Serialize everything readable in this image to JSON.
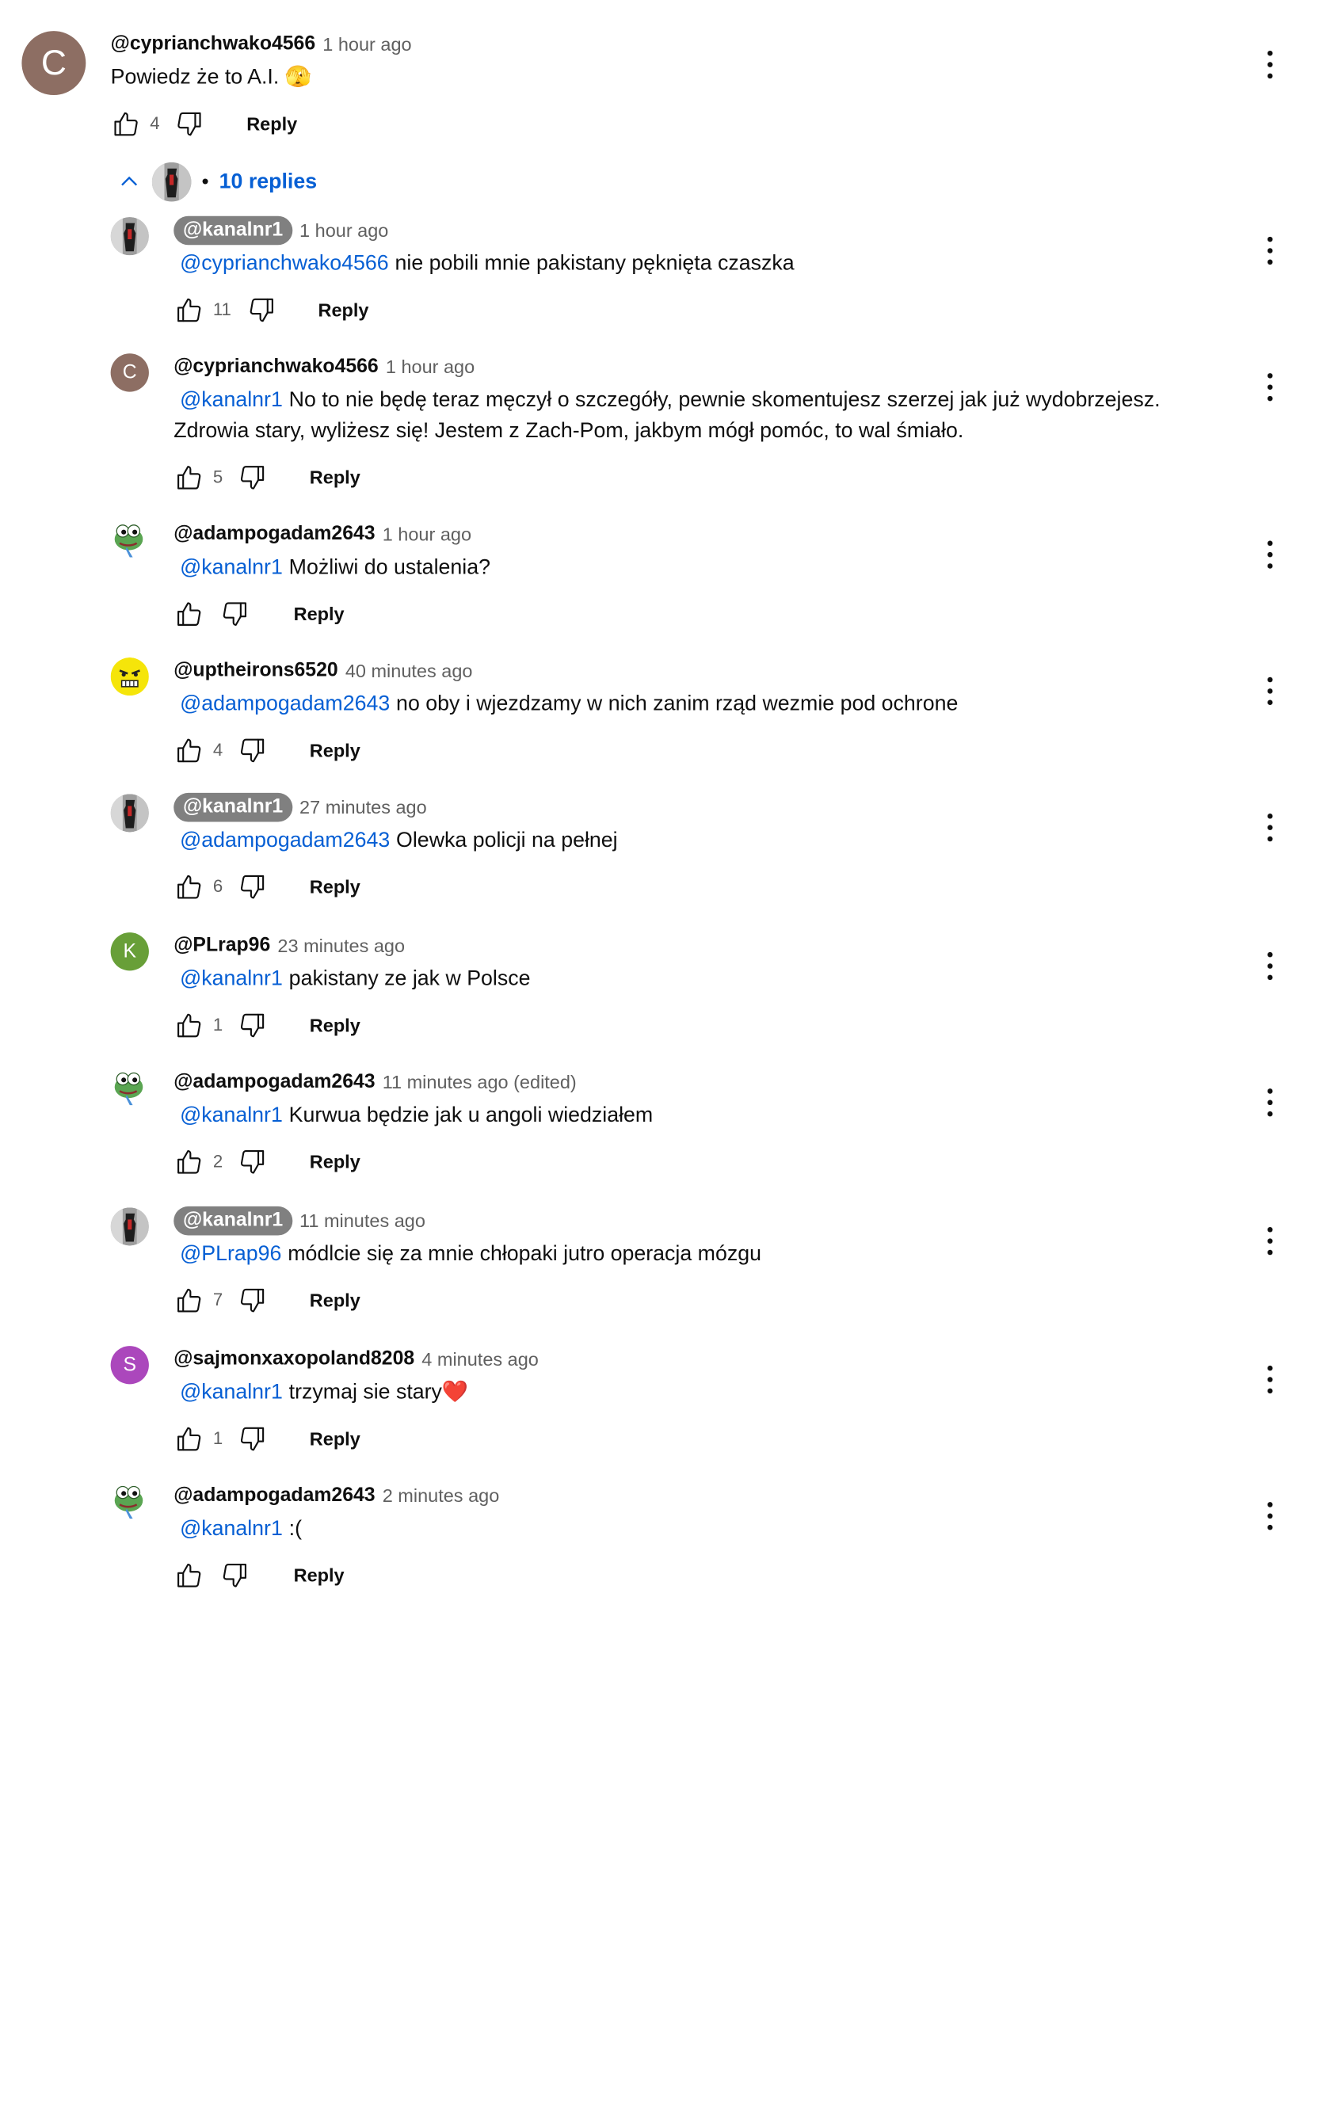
{
  "top_comment": {
    "author": "@cyprianchwako4566",
    "time": "1 hour ago",
    "text": "Powiedz że to A.I. 🫣",
    "likes": "4",
    "reply_label": "Reply",
    "avatar_letter": "C",
    "avatar_color": "#8d6e63"
  },
  "replies_toggle": {
    "count_label": "10 replies",
    "bullet": "•"
  },
  "replies": [
    {
      "author": "@kanalnr1",
      "owner": true,
      "time": "1 hour ago",
      "mention": "@cyprianchwako4566",
      "text": "nie pobili mnie pakistany pęknięta czaszka",
      "likes": "11",
      "reply_label": "Reply",
      "avatar": "photo"
    },
    {
      "author": "@cyprianchwako4566",
      "owner": false,
      "time": "1 hour ago",
      "mention": "@kanalnr1",
      "text": "No to nie będę teraz męczył o szczegóły, pewnie skomentujesz szerzej jak już wydobrzejesz.",
      "text2": "Zdrowia stary, wyliżesz się! Jestem z Zach-Pom, jakbym mógł pomóc, to wal śmiało.",
      "likes": "5",
      "reply_label": "Reply",
      "avatar": "letter",
      "avatar_letter": "C",
      "avatar_color": "#8d6e63"
    },
    {
      "author": "@adampogadam2643",
      "owner": false,
      "time": "1 hour ago",
      "mention": "@kanalnr1",
      "text": "Możliwi do ustalenia?",
      "likes": "",
      "reply_label": "Reply",
      "avatar": "frog"
    },
    {
      "author": "@uptheirons6520",
      "owner": false,
      "time": "40 minutes ago",
      "mention": "@adampogadam2643",
      "text": "no oby i wjezdzamy w nich zanim rząd wezmie pod ochrone",
      "likes": "4",
      "reply_label": "Reply",
      "avatar": "yellow"
    },
    {
      "author": "@kanalnr1",
      "owner": true,
      "time": "27 minutes ago",
      "mention": "@adampogadam2643",
      "text": "Olewka policji na pełnej",
      "likes": "6",
      "reply_label": "Reply",
      "avatar": "photo"
    },
    {
      "author": "@PLrap96",
      "owner": false,
      "time": "23 minutes ago",
      "mention": "@kanalnr1",
      "text": "pakistany ze jak w Polsce",
      "likes": "1",
      "reply_label": "Reply",
      "avatar": "letter",
      "avatar_letter": "K",
      "avatar_color": "#689f38"
    },
    {
      "author": "@adampogadam2643",
      "owner": false,
      "time": "11 minutes ago (edited)",
      "mention": "@kanalnr1",
      "text": "Kurwua będzie jak u angoli wiedziałem",
      "likes": "2",
      "reply_label": "Reply",
      "avatar": "frog"
    },
    {
      "author": "@kanalnr1",
      "owner": true,
      "time": "11 minutes ago",
      "mention": "@PLrap96",
      "text": "módlcie się za mnie chłopaki jutro operacja mózgu",
      "likes": "7",
      "reply_label": "Reply",
      "avatar": "photo"
    },
    {
      "author": "@sajmonxaxopoland8208",
      "owner": false,
      "time": "4 minutes ago",
      "mention": "@kanalnr1",
      "text": "trzymaj sie stary❤️",
      "likes": "1",
      "reply_label": "Reply",
      "avatar": "letter",
      "avatar_letter": "S",
      "avatar_color": "#ab47bc"
    },
    {
      "author": "@adampogadam2643",
      "owner": false,
      "time": "2 minutes ago",
      "mention": "@kanalnr1",
      "text": ":(",
      "likes": "",
      "reply_label": "Reply",
      "avatar": "frog"
    }
  ],
  "icons": {
    "like": "thumb-up-icon",
    "dislike": "thumb-down-icon",
    "more": "more-vert-icon",
    "collapse": "chevron-up-icon"
  },
  "colors": {
    "link": "#065fd4",
    "owner_pill": "#808080",
    "meta": "#606060"
  }
}
